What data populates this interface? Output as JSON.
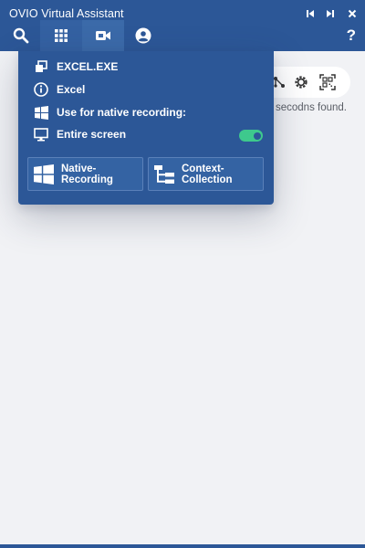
{
  "window": {
    "title": "OVIO Virtual Assistant"
  },
  "toolbar": {
    "tabs": [
      {
        "icon": "search-icon"
      },
      {
        "icon": "apps-grid-icon"
      },
      {
        "icon": "video-camera-icon"
      },
      {
        "icon": "user-account-icon"
      }
    ],
    "active_tab": "video-camera-icon",
    "help_label": "?"
  },
  "background": {
    "status_text": "secodns found."
  },
  "dropdown": {
    "process": "EXCEL.EXE",
    "app_name": "Excel",
    "native_recording_label": "Use for native recording:",
    "target": "Entire screen",
    "target_toggle_on": true,
    "buttons": {
      "native_line1": "Native-",
      "native_line2": "Recording",
      "context_line1": "Context-",
      "context_line2": "Collection"
    }
  },
  "colors": {
    "brand_blue": "#2c5797",
    "toggle_green": "#3ec98d",
    "page_background": "#f1f2f5"
  }
}
